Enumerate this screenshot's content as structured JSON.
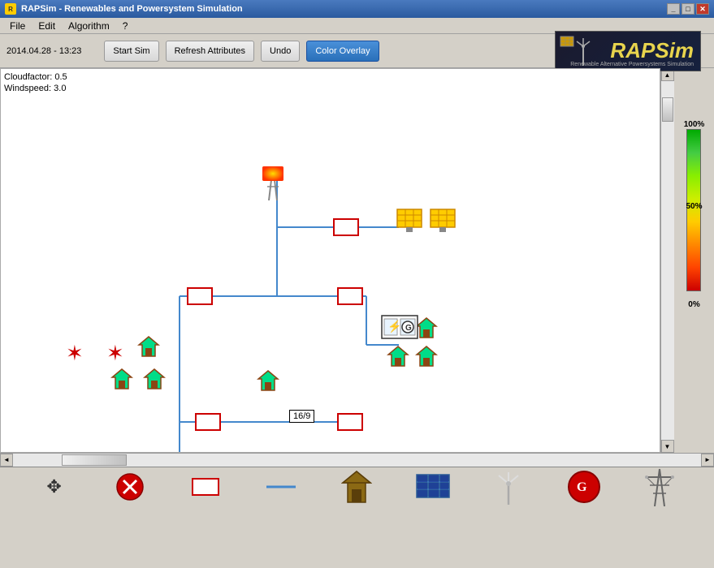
{
  "titlebar": {
    "title": "RAPSim - Renewables and Powersystem Simulation",
    "icon": "★",
    "controls": [
      "_",
      "□",
      "✕"
    ]
  },
  "menubar": {
    "items": [
      "File",
      "Edit",
      "Algorithm",
      "?"
    ]
  },
  "toolbar": {
    "datetime": "2014.04.28 - 13:23",
    "buttons": {
      "start_sim": "Start Sim",
      "refresh_attributes": "Refresh Attributes",
      "undo": "Undo",
      "color_overlay": "Color Overlay"
    }
  },
  "logo": {
    "brand": "RAPSim",
    "subtitle": "Renewable Alternative Powersystems Simulation"
  },
  "sim_info": {
    "cloudfactor": "Cloudfactor: 0.5",
    "windspeed": "Windspeed: 3.0"
  },
  "color_scale": {
    "top_label": "100%",
    "mid_label": "50%",
    "bot_label": "0%"
  },
  "canvas_tooltip": "16/9",
  "bottom_tools": [
    {
      "name": "move",
      "icon": "✥",
      "label": "move-tool"
    },
    {
      "name": "delete",
      "icon": "✕",
      "label": "delete-tool"
    },
    {
      "name": "busbar",
      "icon": "⬜",
      "label": "busbar-tool"
    },
    {
      "name": "wire",
      "icon": "—",
      "label": "wire-tool"
    },
    {
      "name": "house",
      "icon": "⌂",
      "label": "house-tool"
    },
    {
      "name": "solar",
      "icon": "◈",
      "label": "solar-tool"
    },
    {
      "name": "wind",
      "icon": "☴",
      "label": "wind-tool"
    },
    {
      "name": "generator",
      "icon": "⊗",
      "label": "generator-tool"
    },
    {
      "name": "pylon",
      "icon": "⚡",
      "label": "pylon-tool"
    }
  ]
}
